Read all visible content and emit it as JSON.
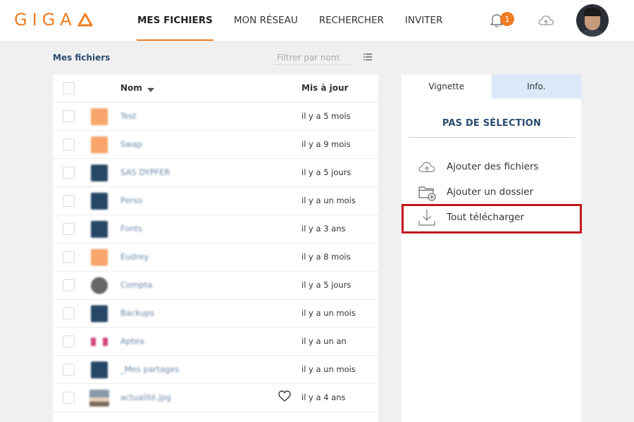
{
  "header": {
    "logo": "GIGA",
    "nav": [
      {
        "label": "MES FICHIERS",
        "active": true
      },
      {
        "label": "MON RÉSEAU",
        "active": false
      },
      {
        "label": "RECHERCHER",
        "active": false
      },
      {
        "label": "INVITER",
        "active": false
      }
    ],
    "notification_count": "1",
    "accent_color": "#ef7d22"
  },
  "toolbar": {
    "breadcrumb": "Mes fichiers",
    "filter_placeholder": "Filtrer par nom"
  },
  "table": {
    "columns": {
      "name": "Nom",
      "date": "Mis à jour"
    },
    "rows": [
      {
        "name": "Test",
        "updated": "il y a 5 mois",
        "icon": "folder-orange-icon"
      },
      {
        "name": "Swap",
        "updated": "il y a 9 mois",
        "icon": "folder-orange-icon"
      },
      {
        "name": "SAS DYPFER",
        "updated": "il y a 5 jours",
        "icon": "folder-navy-icon"
      },
      {
        "name": "Perso",
        "updated": "il y a un mois",
        "icon": "folder-navy-icon"
      },
      {
        "name": "Fonts",
        "updated": "il y a 3 ans",
        "icon": "folder-navy-icon"
      },
      {
        "name": "Eudrey",
        "updated": "il y a 8 mois",
        "icon": "folder-orange-icon"
      },
      {
        "name": "Compta",
        "updated": "il y a 5 jours",
        "icon": "circle-logo-icon"
      },
      {
        "name": "Backups",
        "updated": "il y a un mois",
        "icon": "folder-navy-icon"
      },
      {
        "name": "Aptea",
        "updated": "il y a un an",
        "icon": "pink-logo-icon"
      },
      {
        "name": "_Mes partages",
        "updated": "il y a un mois",
        "icon": "folder-navy-icon"
      },
      {
        "name": "actualité.jpg",
        "updated": "il y a 4 ans",
        "icon": "image-thumb-icon"
      }
    ]
  },
  "panel": {
    "tabs": [
      {
        "label": "Vignette",
        "active": true
      },
      {
        "label": "Info.",
        "active": false
      }
    ],
    "no_selection": "PAS DE SÉLECTION",
    "actions": [
      {
        "label": "Ajouter des fichiers",
        "icon": "cloud-upload-icon"
      },
      {
        "label": "Ajouter un dossier",
        "icon": "folder-add-icon"
      },
      {
        "label": "Tout télécharger",
        "icon": "download-icon"
      }
    ],
    "highlight_color": "#c0161e"
  }
}
